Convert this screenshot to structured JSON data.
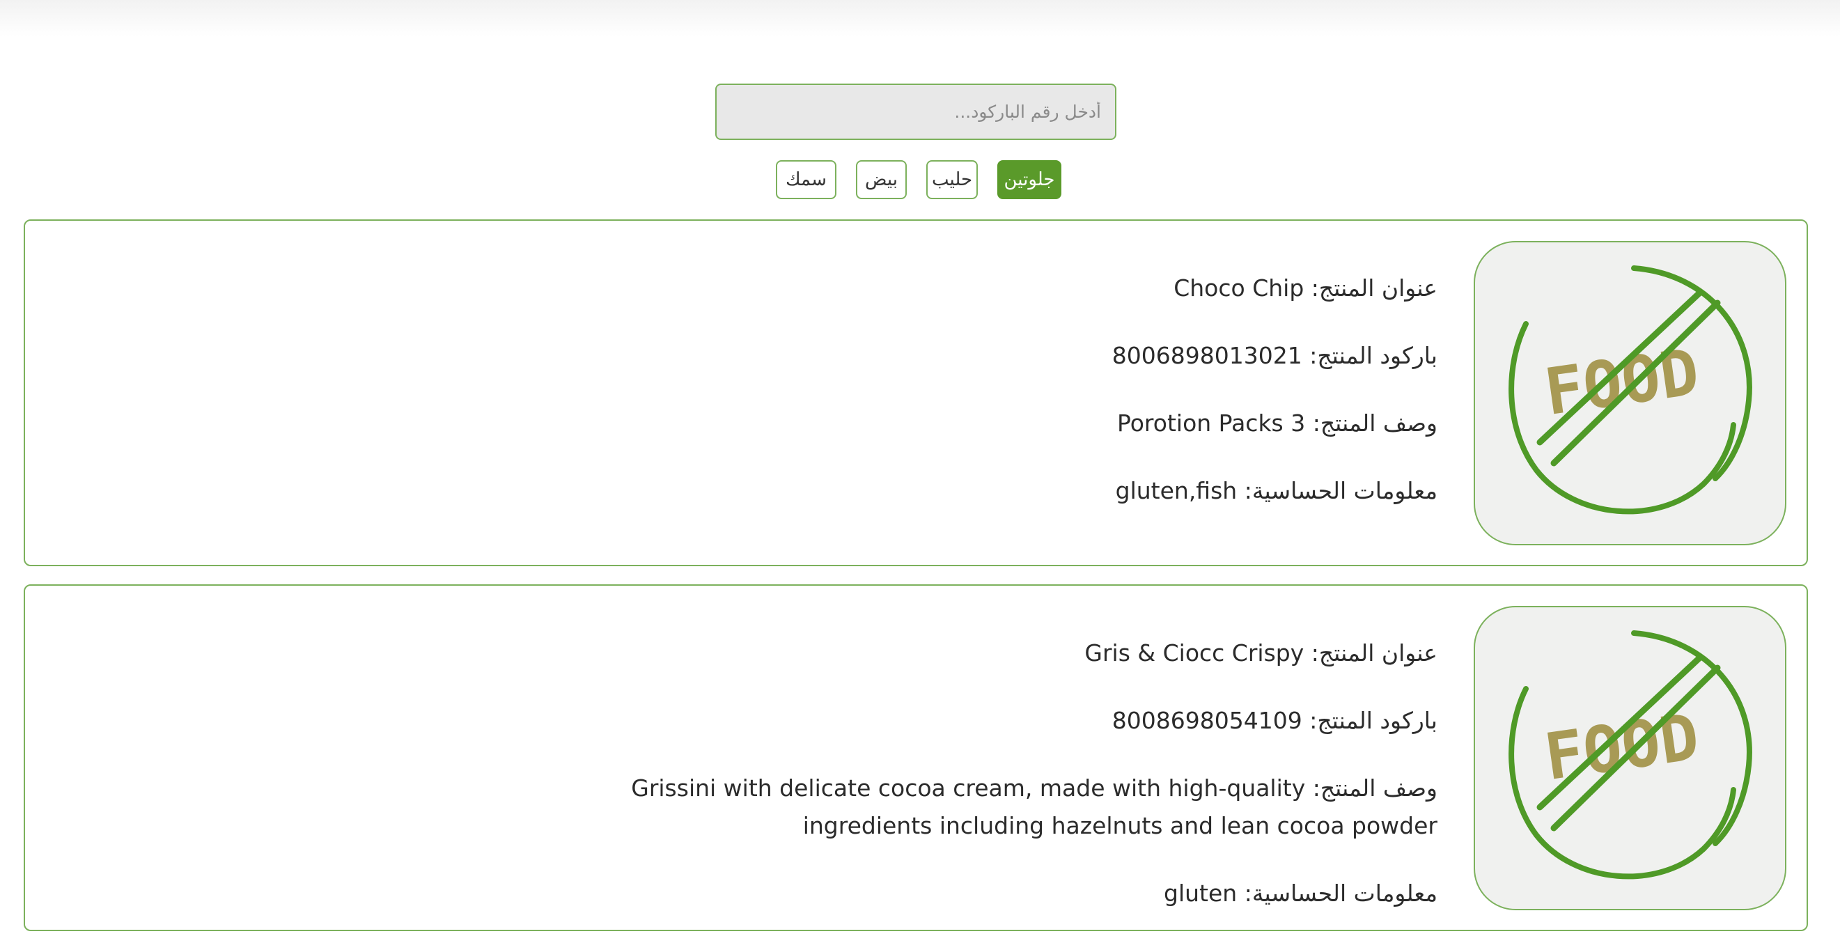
{
  "search": {
    "placeholder": "أدخل رقم الباركود..."
  },
  "filters": [
    {
      "label": "جلوتين",
      "active": true
    },
    {
      "label": "حليب",
      "active": false
    },
    {
      "label": "بيض",
      "active": false
    },
    {
      "label": "سمك",
      "active": false
    }
  ],
  "labels": {
    "title": "عنوان المنتج:",
    "barcode": "باركود المنتج:",
    "description": "وصف المنتج:",
    "allergens": "معلومات الحساسية:"
  },
  "products": [
    {
      "image_icon": "no-food-icon",
      "image_text": "FOOD",
      "title": "Choco Chip",
      "barcode": "8006898013021",
      "description": "Porotion Packs 3",
      "allergens": "gluten,fish"
    },
    {
      "image_icon": "no-food-icon",
      "image_text": "FOOD",
      "title": "Gris & Ciocc Crispy",
      "barcode": "8008698054109",
      "description": "Grissini with delicate cocoa cream, made with high-quality ingredients including hazelnuts and lean cocoa powder",
      "allergens": "gluten"
    }
  ],
  "colors": {
    "accent": "#5a9a2a",
    "border": "#7cb15c",
    "food_text": "#a89a55",
    "thumb_bg": "#f0f1ef"
  }
}
